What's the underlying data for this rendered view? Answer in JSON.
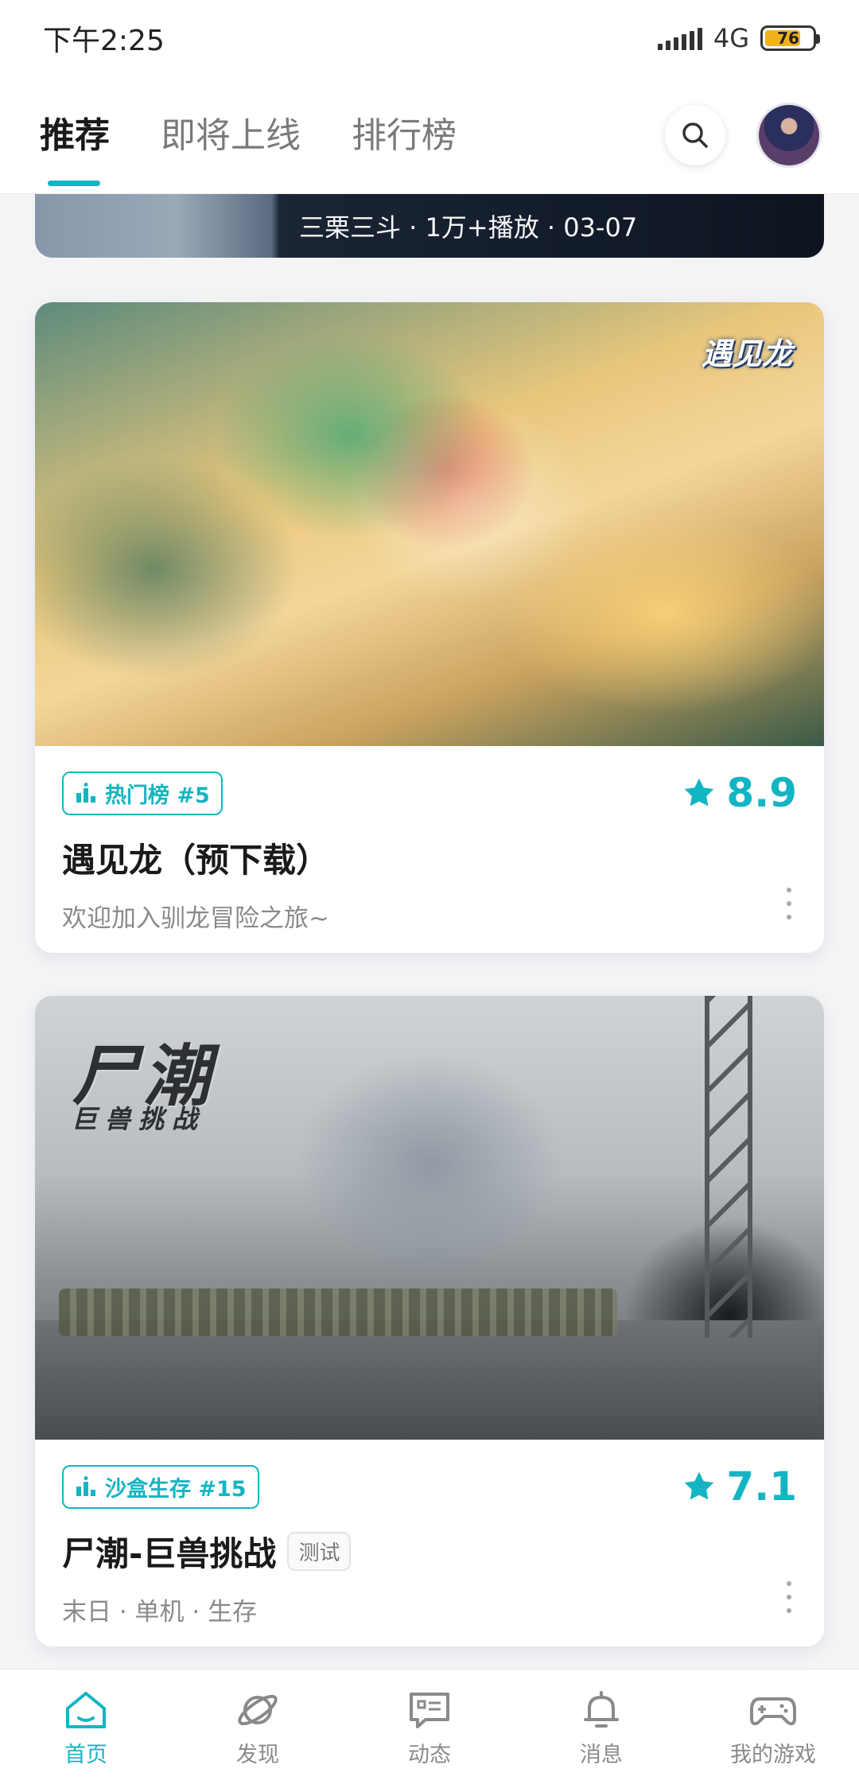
{
  "status_bar": {
    "time": "下午2:25",
    "network": "4G",
    "battery": "76",
    "battery_level": 0.76
  },
  "top_nav": {
    "tabs": [
      {
        "label": "推荐",
        "active": true
      },
      {
        "label": "即将上线",
        "active": false
      },
      {
        "label": "排行榜",
        "active": false
      }
    ],
    "search_icon": "search-icon",
    "avatar": "user-avatar"
  },
  "partial_card": {
    "meta": "三栗三斗 · 1万+播放 · 03-07"
  },
  "cards": [
    {
      "image_logo": "遇见龙",
      "rank_badge": "热门榜 #5",
      "rating": "8.9",
      "title": "遇见龙（预下载）",
      "tag": "",
      "subtitle": "欢迎加入驯龙冒险之旅~"
    },
    {
      "image_logo_title": "尸潮",
      "image_logo_sub": "巨兽挑战",
      "rank_badge": "沙盒生存 #15",
      "rating": "7.1",
      "title": "尸潮-巨兽挑战",
      "tag": "测试",
      "subtitle": "末日 · 单机 · 生存"
    }
  ],
  "bottom_nav": {
    "items": [
      {
        "label": "首页",
        "icon": "home-icon",
        "active": true
      },
      {
        "label": "发现",
        "icon": "planet-icon",
        "active": false
      },
      {
        "label": "动态",
        "icon": "chat-icon",
        "active": false
      },
      {
        "label": "消息",
        "icon": "bell-icon",
        "active": false
      },
      {
        "label": "我的游戏",
        "icon": "gamepad-icon",
        "active": false
      }
    ]
  },
  "colors": {
    "accent": "#14b5c2",
    "text_primary": "#1a1a1a",
    "text_secondary": "#8a8a8a"
  }
}
